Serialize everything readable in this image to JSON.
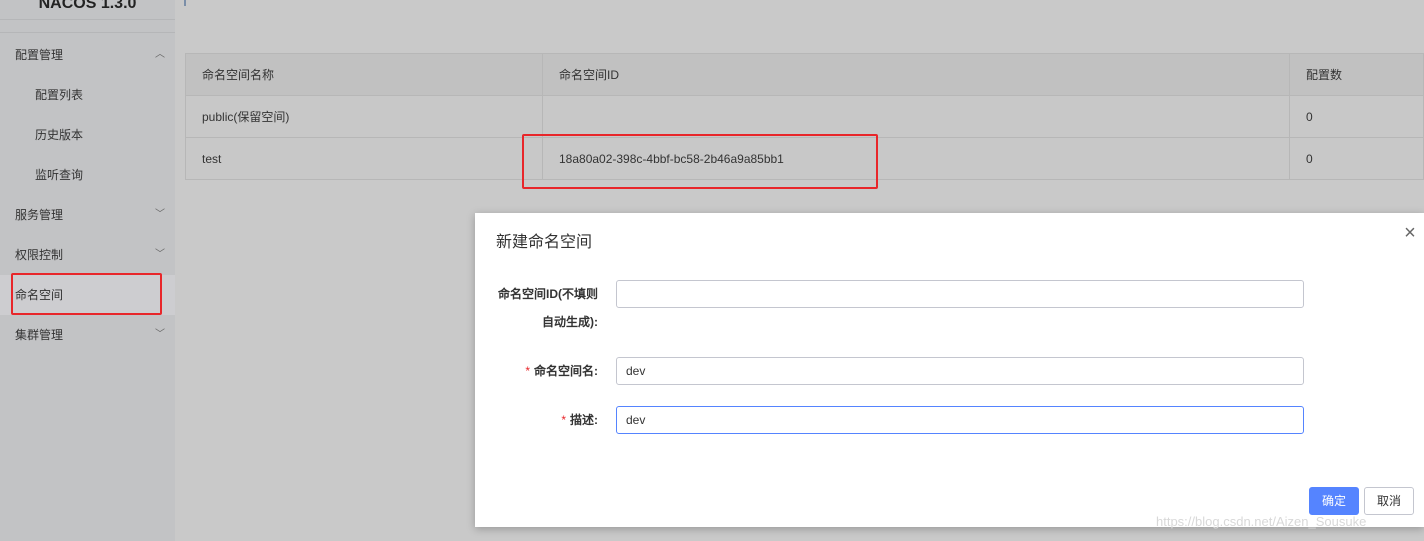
{
  "app": {
    "brand": "NACOS 1.3.0"
  },
  "sidebar": {
    "items": [
      {
        "label": "配置管理",
        "expanded": true
      },
      {
        "label": "配置列表",
        "sub": true
      },
      {
        "label": "历史版本",
        "sub": true
      },
      {
        "label": "监听查询",
        "sub": true
      },
      {
        "label": "服务管理",
        "expanded": false
      },
      {
        "label": "权限控制",
        "expanded": false
      },
      {
        "label": "命名空间",
        "active": true
      },
      {
        "label": "集群管理",
        "expanded": false
      }
    ]
  },
  "table": {
    "headers": [
      "命名空间名称",
      "命名空间ID",
      "配置数"
    ],
    "rows": [
      {
        "name": "public(保留空间)",
        "id": "",
        "count": "0"
      },
      {
        "name": "test",
        "id": "18a80a02-398c-4bbf-bc58-2b46a9a85bb1",
        "count": "0"
      }
    ]
  },
  "dialog": {
    "title": "新建命名空间",
    "fields": {
      "ns_id": {
        "label_line1": "命名空间ID(不填则",
        "label_line2": "自动生成):",
        "value": ""
      },
      "ns_name": {
        "required": "*",
        "label": "命名空间名:",
        "value": "dev"
      },
      "desc": {
        "required": "*",
        "label": "描述:",
        "value": "dev"
      }
    },
    "ok_label": "确定",
    "cancel_label": "取消"
  },
  "watermark": "https://blog.csdn.net/Aizen_Sousuke",
  "colors": {
    "primary": "#5584ff",
    "highlight": "#e8262a",
    "required": "#e8262a"
  }
}
